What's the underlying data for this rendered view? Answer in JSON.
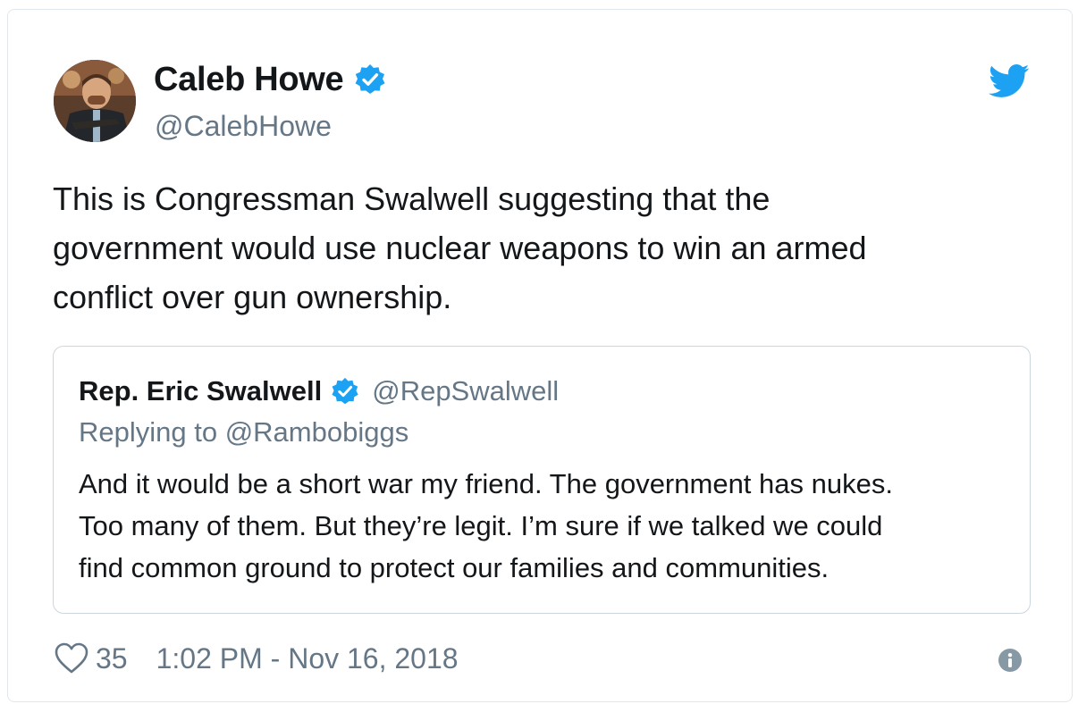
{
  "author": {
    "name": "Caleb Howe",
    "handle": "@CalebHowe",
    "verified_icon": "verified-badge-icon",
    "avatar": "avatar-photo"
  },
  "brand": {
    "icon": "twitter-bird-icon",
    "color": "#1da1f2"
  },
  "tweet": {
    "text": "This is Congressman Swalwell suggesting that the\ngovernment would use nuclear weapons to win an armed\nconflict over gun ownership."
  },
  "quoted_tweet": {
    "name": "Rep. Eric Swalwell",
    "handle": "@RepSwalwell",
    "reply_context": "Replying to @Rambobiggs",
    "text": "And it would be a short war my friend. The government has nukes.\nToo many of them. But they’re legit. I’m sure if we talked we could\nfind common ground to protect our families and communities."
  },
  "footer": {
    "like_icon": "heart-icon",
    "likes": "35",
    "timestamp": "1:02 PM - Nov 16, 2018",
    "info_icon": "info-icon"
  },
  "colors": {
    "text_primary": "#14171a",
    "text_secondary": "#657786",
    "border": "#e1e8ed",
    "verified": "#1da1f2"
  }
}
